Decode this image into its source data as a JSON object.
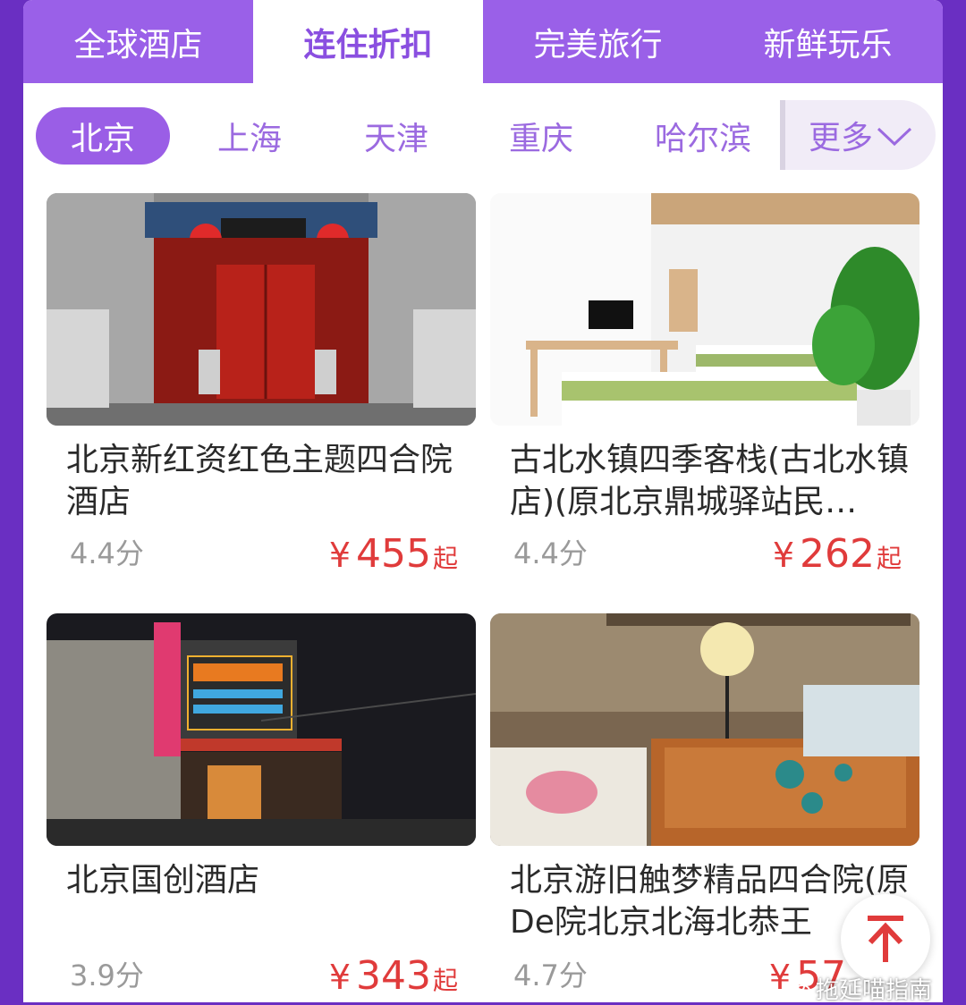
{
  "tabs": [
    {
      "label": "全球酒店"
    },
    {
      "label": "连住折扣"
    },
    {
      "label": "完美旅行"
    },
    {
      "label": "新鲜玩乐"
    }
  ],
  "cities": [
    {
      "label": "北京"
    },
    {
      "label": "上海"
    },
    {
      "label": "天津"
    },
    {
      "label": "重庆"
    },
    {
      "label": "哈尔滨"
    }
  ],
  "more": {
    "label": "更多",
    "icon": "chevron-down-icon"
  },
  "hotels": [
    {
      "name": "北京新红资红色主题四合院酒店",
      "rating": "4.4分",
      "currency": "¥",
      "price": "455",
      "suffix": "起"
    },
    {
      "name": "古北水镇四季客栈(古北水镇店)(原北京鼎城驿站民…",
      "rating": "4.4分",
      "currency": "¥",
      "price": "262",
      "suffix": "起"
    },
    {
      "name": "北京国创酒店",
      "rating": "3.9分",
      "currency": "¥",
      "price": "343",
      "suffix": "起"
    },
    {
      "name": "北京游旧触梦精品四合院(原De院北京北海北恭王",
      "rating": "4.7分",
      "currency": "¥",
      "price": "57",
      "suffix": ""
    }
  ],
  "back_to_top": {
    "icon": "arrow-up-icon"
  },
  "watermark": {
    "text": "拖延喵指南"
  }
}
